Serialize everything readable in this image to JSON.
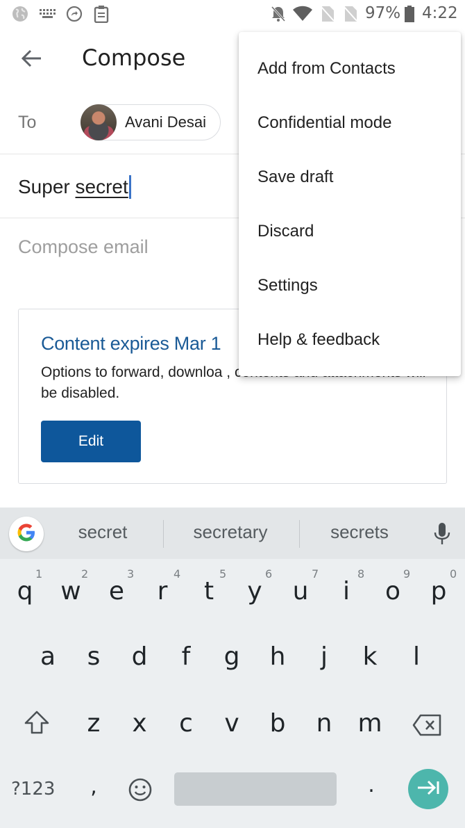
{
  "status_bar": {
    "left_icons": [
      "globe-icon",
      "keyboard-icon",
      "share-arrow-icon",
      "clipboard-icon"
    ],
    "right_icons": [
      "bell-off-icon",
      "wifi-icon",
      "no-sim-icon",
      "no-sim-icon"
    ],
    "battery_percent": "97%",
    "time": "4:22"
  },
  "app_bar": {
    "back_icon": "arrow-back-icon",
    "title": "Compose"
  },
  "compose": {
    "to_label": "To",
    "recipient": {
      "name": "Avani Desai"
    },
    "subject_prefix": "Super ",
    "subject_word": "secret",
    "body_placeholder": "Compose email"
  },
  "confidential_card": {
    "title": "Content expires Mar 1",
    "description": "Options to forward, downloa ,                       contents and attachments will be disabled.",
    "edit_label": "Edit",
    "title_color": "#1a5a96",
    "button_color": "#0e579b"
  },
  "overflow_menu": {
    "items": [
      {
        "label": "Add from Contacts"
      },
      {
        "label": "Confidential mode"
      },
      {
        "label": "Save draft"
      },
      {
        "label": "Discard"
      },
      {
        "label": "Settings"
      },
      {
        "label": "Help & feedback"
      }
    ]
  },
  "keyboard": {
    "suggestions": [
      "secret",
      "secretary",
      "secrets"
    ],
    "row1": [
      "q",
      "w",
      "e",
      "r",
      "t",
      "y",
      "u",
      "i",
      "o",
      "p"
    ],
    "row1_hints": [
      "1",
      "2",
      "3",
      "4",
      "5",
      "6",
      "7",
      "8",
      "9",
      "0"
    ],
    "row2": [
      "a",
      "s",
      "d",
      "f",
      "g",
      "h",
      "j",
      "k",
      "l"
    ],
    "row3": [
      "z",
      "x",
      "c",
      "v",
      "b",
      "n",
      "m"
    ],
    "symbols_label": "?123",
    "comma": ",",
    "period": ".",
    "accent_color": "#4db6ac"
  }
}
